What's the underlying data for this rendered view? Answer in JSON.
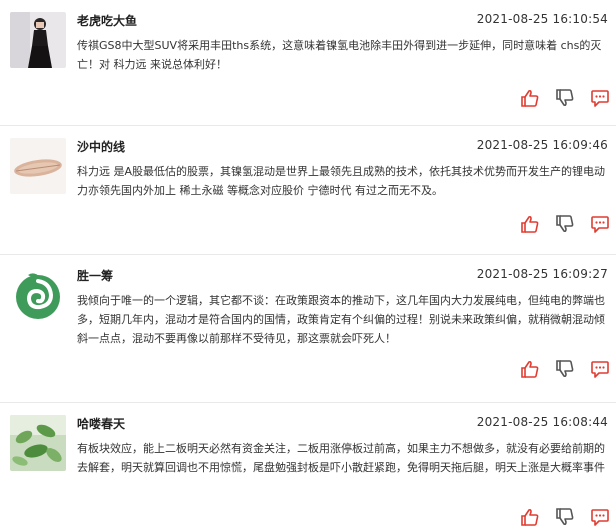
{
  "comments": [
    {
      "username": "老虎吃大鱼",
      "time": "2021-08-25 16:10:54",
      "text": "传祺GS8中大型SUV将采用丰田ths系统，这意味着镍氢电池除丰田外得到进一步延伸，同时意味着 chs的灭亡！对 科力远 来说总体利好！",
      "avatar_icon": "person-photo-avatar"
    },
    {
      "username": "沙中的线",
      "time": "2021-08-25 16:09:46",
      "text": "科力远 是A股最低估的股票，其镍氢混动是世界上最领先且成熟的技术，依托其技术优势而开发生产的锂电动力亦领先国内外加上 稀土永磁 等概念对应股价 宁德时代 有过之而无不及。",
      "avatar_icon": "feather-avatar"
    },
    {
      "username": "胜一筹",
      "time": "2021-08-25 16:09:27",
      "text": "我倾向于唯一的一个逻辑，其它都不谈：在政策跟资本的推动下，这几年国内大力发展纯电，但纯电的弊端也多，短期几年内，混动才是符合国内的国情，政策肯定有个纠偏的过程！别说未来政策纠偏，就稍微朝混动倾斜一点点，混动不要再像以前那样不受待见，那这票就会吓死人！",
      "avatar_icon": "green-swirl-avatar"
    },
    {
      "username": "哈喽春天",
      "time": "2021-08-25 16:08:44",
      "text": "有板块效应，能上二板明天必然有资金关注，二板用涨停板过前高，如果主力不想做多，就没有必要给前期的去解套，明天就算回调也不用惊慌，尾盘勉强封板是吓小散赶紧跑，免得明天拖后腿，明天上涨是大概率事件",
      "avatar_icon": "plant-photo-avatar"
    }
  ],
  "colors": {
    "icon_red": "#e03c31",
    "icon_gray": "#555555",
    "divider": "#e9e9e9"
  },
  "action_icons": [
    "thumbs-up-icon",
    "thumbs-down-icon",
    "comment-icon"
  ]
}
